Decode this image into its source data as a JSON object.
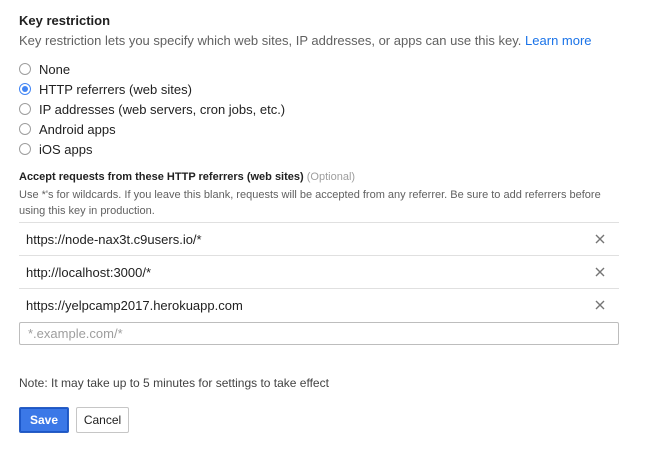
{
  "key_restriction": {
    "title": "Key restriction",
    "description": "Key restriction lets you specify which web sites, IP addresses, or apps can use this key.",
    "learn_more": "Learn more",
    "options": [
      {
        "label": "None",
        "checked": false
      },
      {
        "label": "HTTP referrers (web sites)",
        "checked": true
      },
      {
        "label": "IP addresses (web servers, cron jobs, etc.)",
        "checked": false
      },
      {
        "label": "Android apps",
        "checked": false
      },
      {
        "label": "iOS apps",
        "checked": false
      }
    ]
  },
  "referrers": {
    "title": "Accept requests from these HTTP referrers (web sites)",
    "optional": "(Optional)",
    "description": "Use *'s for wildcards. If you leave this blank, requests will be accepted from any referrer. Be sure to add referrers before using this key in production.",
    "items": [
      "https://node-nax3t.c9users.io/*",
      "http://localhost:3000/*",
      "https://yelpcamp2017.herokuapp.com"
    ],
    "input_placeholder": "*.example.com/*",
    "input_value": "",
    "remove_icon": "close-icon"
  },
  "note": "Note: It may take up to 5 minutes for settings to take effect",
  "actions": {
    "save_label": "Save",
    "cancel_label": "Cancel"
  },
  "colors": {
    "accent": "#4285f4",
    "save_button": "#3b78e7",
    "link": "#1a73e8"
  }
}
